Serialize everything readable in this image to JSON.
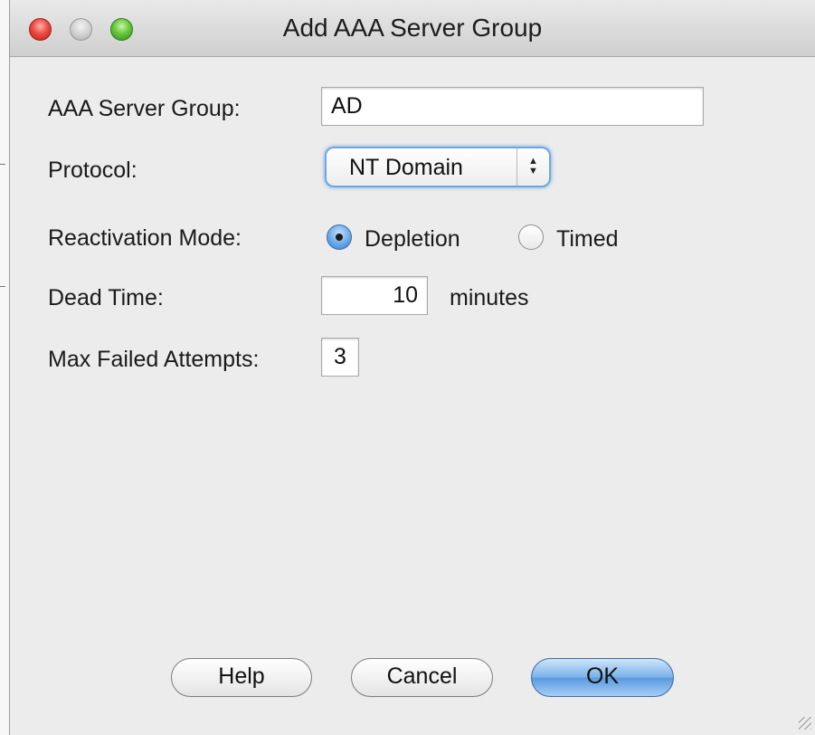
{
  "window": {
    "title": "Add AAA Server Group"
  },
  "form": {
    "server_group": {
      "label": "AAA Server Group:",
      "value": "AD"
    },
    "protocol": {
      "label": "Protocol:",
      "selected": "NT Domain",
      "arrows": "▲\n▼"
    },
    "reactivation_mode": {
      "label": "Reactivation Mode:",
      "options": [
        {
          "label": "Depletion",
          "selected": true
        },
        {
          "label": "Timed",
          "selected": false
        }
      ]
    },
    "dead_time": {
      "label": "Dead Time:",
      "value": "10",
      "unit": "minutes"
    },
    "max_failed_attempts": {
      "label": "Max Failed Attempts:",
      "value": "3"
    }
  },
  "buttons": {
    "help": "Help",
    "cancel": "Cancel",
    "ok": "OK"
  },
  "colors": {
    "focus_ring": "#6fa6dd",
    "default_button": "#7cb3ea",
    "close_button": "#ee4b42",
    "zoom_button": "#69c83e"
  }
}
